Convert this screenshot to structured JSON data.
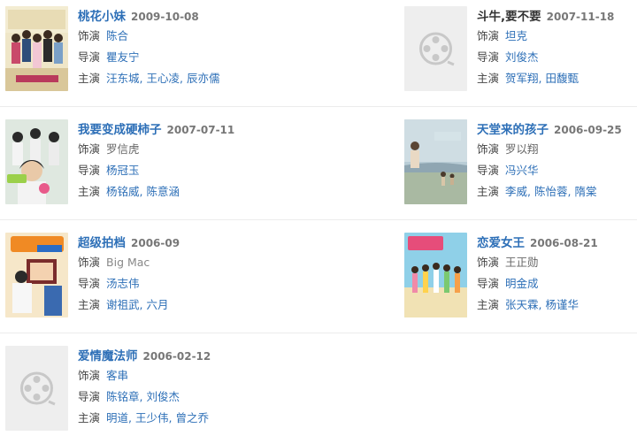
{
  "movies": [
    {
      "title": "桃花小妹",
      "date": "2009-10-08",
      "roles": [
        {
          "label": "饰演",
          "names": [
            "陈合"
          ]
        },
        {
          "label": "导演",
          "names": [
            "瞿友宁"
          ]
        },
        {
          "label": "主演",
          "names": [
            "汪东城",
            "王心凌",
            "辰亦儒"
          ]
        }
      ]
    },
    {
      "title": "斗牛,要不要",
      "date": "2007-11-18",
      "roles": [
        {
          "label": "饰演",
          "names": [
            "坦克"
          ]
        },
        {
          "label": "导演",
          "names": [
            "刘俊杰"
          ]
        },
        {
          "label": "主演",
          "names": [
            "贺军翔",
            "田馥甄"
          ]
        }
      ]
    },
    {
      "title": "我要变成硬柿子",
      "date": "2007-07-11",
      "roles": [
        {
          "label": "饰演",
          "names": [
            "罗信虎"
          ]
        },
        {
          "label": "导演",
          "names": [
            "杨冠玉"
          ]
        },
        {
          "label": "主演",
          "names": [
            "杨铭威",
            "陈意涵"
          ]
        }
      ]
    },
    {
      "title": "天堂来的孩子",
      "date": "2006-09-25",
      "roles": [
        {
          "label": "饰演",
          "names": [
            "罗以翔"
          ]
        },
        {
          "label": "导演",
          "names": [
            "冯兴华"
          ]
        },
        {
          "label": "主演",
          "names": [
            "李威",
            "陈怡蓉",
            "隋棠"
          ]
        }
      ]
    },
    {
      "title": "超级拍档",
      "date": "2006-09",
      "roles": [
        {
          "label": "饰演",
          "names": [
            "Big Mac"
          ]
        },
        {
          "label": "导演",
          "names": [
            "汤志伟"
          ]
        },
        {
          "label": "主演",
          "names": [
            "谢祖武",
            "六月"
          ]
        }
      ]
    },
    {
      "title": "恋爱女王",
      "date": "2006-08-21",
      "roles": [
        {
          "label": "饰演",
          "names": [
            "王正勋"
          ]
        },
        {
          "label": "导演",
          "names": [
            "明金成"
          ]
        },
        {
          "label": "主演",
          "names": [
            "张天霖",
            "杨谨华"
          ]
        }
      ]
    },
    {
      "title": "爱情魔法师",
      "date": "2006-02-12",
      "roles": [
        {
          "label": "饰演",
          "names": [
            "客串"
          ]
        },
        {
          "label": "导演",
          "names": [
            "陈铭章",
            "刘俊杰"
          ]
        },
        {
          "label": "主演",
          "names": [
            "明道",
            "王少伟",
            "曾之乔"
          ]
        }
      ]
    }
  ],
  "poster_placeholder_icon": "film-reel-icon",
  "colors": {
    "link": "#2d6fb7",
    "date": "#777777",
    "divider": "#ececec"
  }
}
